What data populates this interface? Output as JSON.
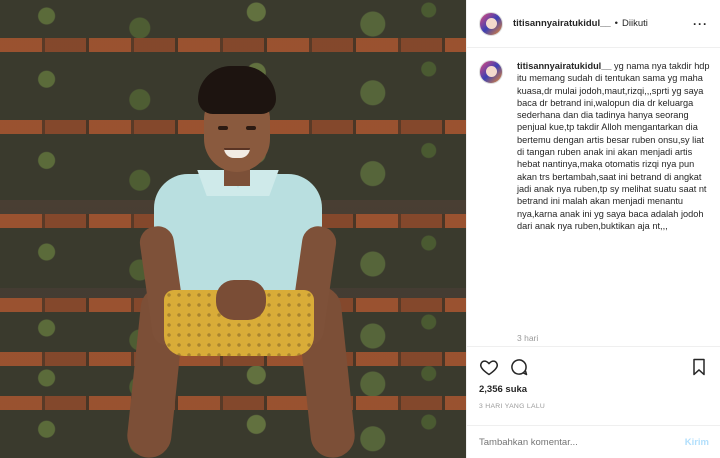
{
  "post": {
    "username": "titisannyairatukidul__",
    "separator": "•",
    "follow_status": "Diikuti",
    "more_icon": "more-dots-icon",
    "caption_username": "titisannyairatukidul__",
    "caption_text": " yg nama nya takdir hdp itu memang sudah di tentukan sama yg maha kuasa,dr mulai jodoh,maut,rizqi,,,sprti yg saya baca dr betrand ini,walopun dia dr keluarga sederhana dan dia tadinya hanya seorang penjual kue,tp takdir Alloh mengantarkan dia bertemu dengan artis besar ruben onsu,sy liat di tangan ruben anak ini akan menjadi artis hebat nantinya,maka otomatis rizqi nya pun akan trs bertambah,saat ini betrand di angkat jadi anak nya ruben,tp sy melihat suatu saat nt betrand ini malah akan menjadi menantu nya,karna anak ini yg saya baca adalah jodoh dari anak nya ruben,buktikan aja nt,,,",
    "caption_time": "3 hari",
    "likes": "2,356 suka",
    "posted_ago": "3 HARI YANG LALU",
    "comment_placeholder": "Tambahkan komentar...",
    "send_label": "Kirim",
    "icons": {
      "like": "heart-icon",
      "comment": "comment-bubble-icon",
      "save": "bookmark-icon"
    }
  },
  "colors": {
    "text": "#262626",
    "muted": "#999999",
    "border": "#efefef",
    "send_disabled": "#b2dffc"
  }
}
